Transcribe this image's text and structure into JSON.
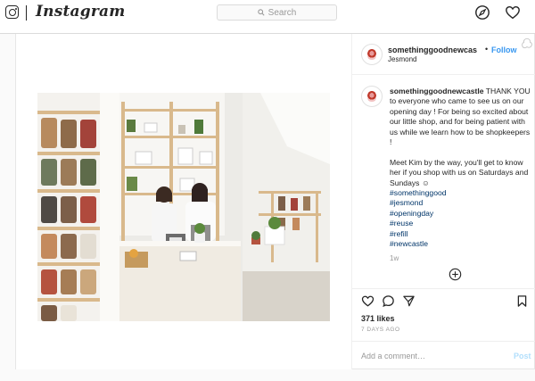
{
  "header": {
    "wordmark": "Instagram",
    "search_placeholder": "Search",
    "icons": [
      "instagram-glyph-icon",
      "compass-icon",
      "heart-icon"
    ]
  },
  "post": {
    "username": "somethinggoodnewcas",
    "follow_label": "Follow",
    "dot": "•",
    "location": "Jesmond",
    "caption": {
      "username": "somethinggoodnewcastle",
      "text": " THANK YOU to everyone who came to see us on our opening day ! For being so excited about our little shop, and for being patient with us while we learn how to be shopkeepers !\n\nMeet Kim by the way, you'll get to know her if you shop with us on Saturdays and Sundays ☺",
      "hashtags": [
        "#somethinggood",
        "#jesmond",
        "#openingday",
        "#reuse",
        "#refill",
        "#newcastle"
      ]
    },
    "caption_time": "1w",
    "likes": "371 likes",
    "date": "7 DAYS AGO",
    "comment_placeholder": "Add a comment…",
    "post_label": "Post"
  },
  "colors": {
    "link_blue": "#3897f0",
    "hashtag": "#003569",
    "muted": "#999999",
    "border": "#dbdbdb"
  }
}
